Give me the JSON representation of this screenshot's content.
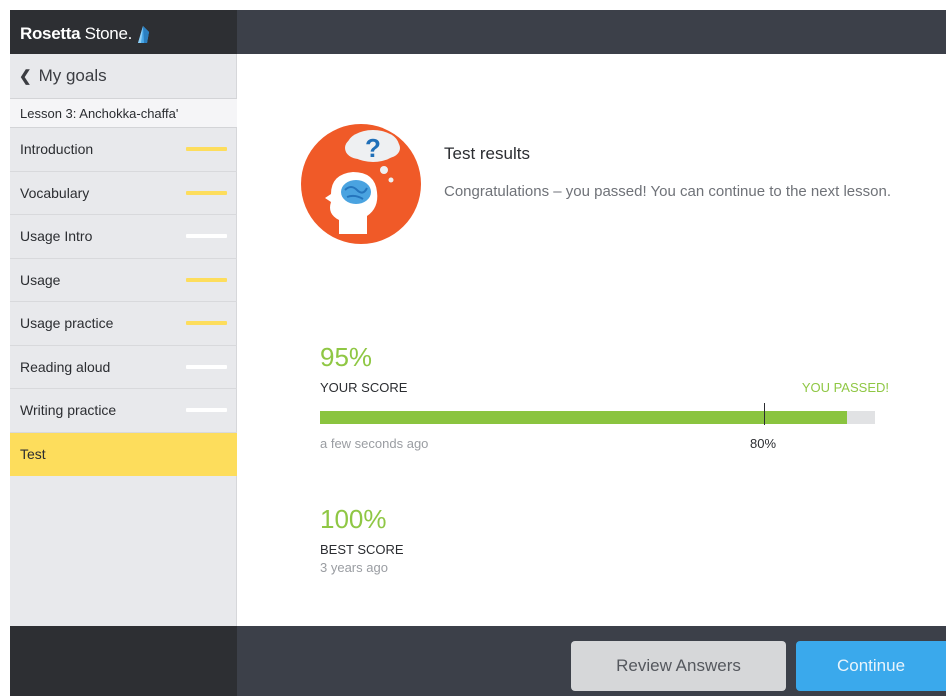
{
  "header": {
    "logo_text_bold": "Rosetta",
    "logo_text_light": " Stone."
  },
  "sidebar": {
    "back_label": "My goals",
    "lesson_title": "Lesson 3: Anchokka-chaffa'",
    "items": [
      {
        "label": "Introduction",
        "progress_color": "#fddd5c",
        "active": false
      },
      {
        "label": "Vocabulary",
        "progress_color": "#fddd5c",
        "active": false
      },
      {
        "label": "Usage Intro",
        "progress_color": "#ffffff",
        "active": false
      },
      {
        "label": "Usage",
        "progress_color": "#fddd5c",
        "active": false
      },
      {
        "label": "Usage practice",
        "progress_color": "#fddd5c",
        "active": false
      },
      {
        "label": "Reading aloud",
        "progress_color": "#ffffff",
        "active": false
      },
      {
        "label": "Writing practice",
        "progress_color": "#ffffff",
        "active": false
      },
      {
        "label": "Test",
        "progress_color": "",
        "active": true
      }
    ]
  },
  "results": {
    "title": "Test results",
    "message": "Congratulations – you passed! You can continue to the next lesson.",
    "score": {
      "percent_text": "95%",
      "value": 95,
      "label": "YOUR SCORE",
      "status": "YOU PASSED!",
      "time": "a few seconds ago",
      "threshold_value": 80,
      "threshold_text": "80%"
    },
    "best": {
      "percent_text": "100%",
      "label": "BEST SCORE",
      "time": "3 years ago"
    }
  },
  "footer": {
    "review_label": "Review Answers",
    "continue_label": "Continue"
  },
  "colors": {
    "accent_green": "#8ac43f",
    "accent_yellow": "#fddd5c",
    "accent_blue": "#3aa9ec",
    "illustration_orange": "#f05a28"
  },
  "icons": {
    "back": "chevron-left-icon",
    "illustration": "thinking-head-question-icon"
  }
}
